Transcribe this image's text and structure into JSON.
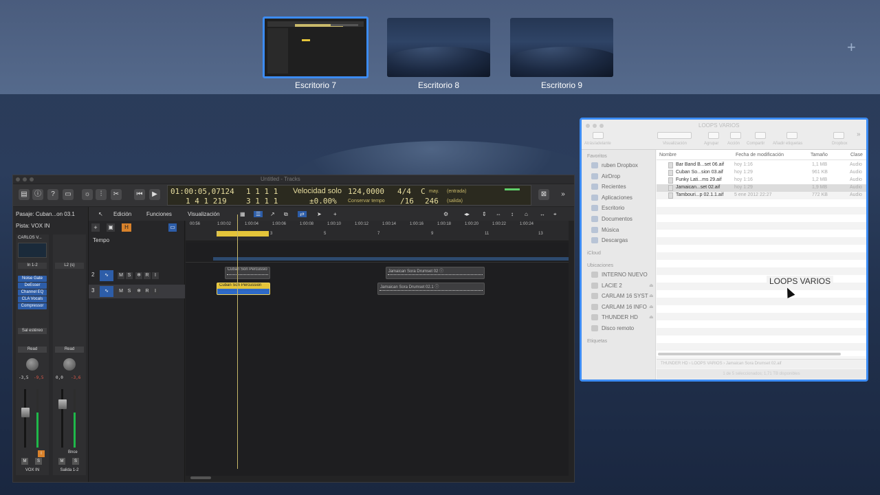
{
  "mission_control": {
    "desktops": [
      {
        "label": "Escritorio 7",
        "active": true
      },
      {
        "label": "Escritorio 8",
        "active": false
      },
      {
        "label": "Escritorio 9",
        "active": false
      }
    ],
    "add_icon": "plus-icon"
  },
  "logic": {
    "title": "Untitled - Tracks",
    "lcd": {
      "time": "01:00:05,07124",
      "time_sub": "1  1  1     1",
      "position": "1  4  1  219",
      "position_sub": "3  1  1     1",
      "mode": "Velocidad solo",
      "tempo": "124,0000",
      "tempo_sub": "±0.00%",
      "tempo_label": "Conservar tempo",
      "signature": "4/4",
      "signature_sub": "/16",
      "key": "C",
      "key_mode": "may.",
      "bpm2": "246",
      "in_label": "(entrada)",
      "out_label": "(salida)"
    },
    "inspector": {
      "region_label": "Pasaje: Cuban...on 03.1",
      "track_label": "Pista: VOX IN",
      "strip1": {
        "name": "CARLOS V...",
        "input": "In 1-2",
        "plugins": [
          "Noise Gate",
          "DeEsser",
          "Channel EQ",
          "CLA Vocals",
          "Compressor"
        ],
        "output": "Sal estéreo",
        "automation": "Read",
        "vol": "-3,5",
        "peak": "-9,5",
        "label": "VOX IN"
      },
      "strip2": {
        "input": "L2 (s)",
        "automation": "Read",
        "vol": "0,0",
        "peak": "-3,6",
        "bnce": "Bnce",
        "label": "Salida 1-2"
      },
      "mute": "M",
      "solo": "S"
    },
    "menus": [
      "Edición",
      "Funciones",
      "Visualización"
    ],
    "tempo_track": "Tempo",
    "ruler": {
      "bars": [
        "1",
        "3",
        "5",
        "7",
        "9",
        "11",
        "13"
      ],
      "times": [
        "00:56",
        "1:00:02",
        "1:00:04",
        "1:00:06",
        "1:00:08",
        "1:00:10",
        "1:00:12",
        "1:00:14",
        "1:00:16",
        "1:00:18",
        "1:00:20",
        "1:00:22",
        "1:00:24"
      ]
    },
    "tracks": [
      {
        "num": "2",
        "buttons": [
          "M",
          "S",
          "❄",
          "R",
          "I"
        ]
      },
      {
        "num": "3",
        "buttons": [
          "M",
          "S",
          "❄",
          "R",
          "I"
        ]
      }
    ],
    "regions": [
      {
        "name": "Cuban Son Percussio",
        "lane": 0,
        "start_bar": 1.3,
        "end_bar": 3.0,
        "selected": false
      },
      {
        "name": "Jamaican Sora Drumset 02  ⓘ",
        "lane": 0,
        "start_bar": 7.3,
        "end_bar": 11.0,
        "selected": false
      },
      {
        "name": "Cuban Son Percussion",
        "lane": 1,
        "start_bar": 1.0,
        "end_bar": 3.0,
        "selected": true
      },
      {
        "name": "Jamaican Sora Drumset 02.1  ⓘ",
        "lane": 1,
        "start_bar": 7.0,
        "end_bar": 11.0,
        "selected": false
      }
    ]
  },
  "finder": {
    "title": "LOOPS VARIOS",
    "toolbar": [
      "Atrás/adelante",
      "Visualización",
      "Agrupar",
      "Acción",
      "Compartir",
      "Añadir etiquetas",
      "Dropbox"
    ],
    "sidebar": {
      "favoritos_h": "Favoritos",
      "favoritos": [
        "ruben Dropbox",
        "AirDrop",
        "Recientes",
        "Aplicaciones",
        "Escritorio",
        "Documentos",
        "Música",
        "Descargas"
      ],
      "icloud_h": "iCloud",
      "ubicaciones_h": "Ubicaciones",
      "ubicaciones": [
        "INTERNO NUEVO",
        "LACIE 2",
        "CARLAM 16 SYST",
        "CARLAM 16 INFO",
        "THUNDER HD",
        "Disco remoto"
      ],
      "etiquetas_h": "Etiquetas"
    },
    "columns": {
      "name": "Nombre",
      "date": "Fecha de modificación",
      "size": "Tamaño",
      "kind": "Clase"
    },
    "files": [
      {
        "name": "Bar Band B...set 06.aif",
        "date": "hoy 1:16",
        "size": "1,1 MB",
        "kind": "Audio"
      },
      {
        "name": "Cuban So...sion 03.aif",
        "date": "hoy 1:29",
        "size": "961 KB",
        "kind": "Audio"
      },
      {
        "name": "Funky Lati...ms 29.aif",
        "date": "hoy 1:16",
        "size": "1,2 MB",
        "kind": "Audio"
      },
      {
        "name": "Jamaican...set 02.aif",
        "date": "hoy 1:29",
        "size": "1,9 MB",
        "kind": "Audio"
      },
      {
        "name": "Tambouri...p 02.1.1.aif",
        "date": "5 ene 2012 22:27",
        "size": "772 KB",
        "kind": "Audio"
      }
    ],
    "drag_label": "LOOPS VARIOS",
    "path": "THUNDER HD  ›  LOOPS VARIOS  ›  Jamaican Sora Drumset 02.aif",
    "status": "1 de 5 seleccionados; 1,71 TB disponibles"
  }
}
